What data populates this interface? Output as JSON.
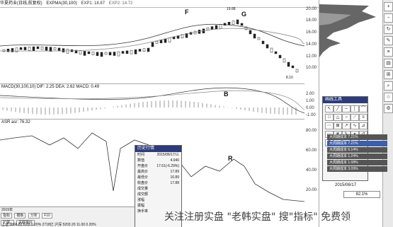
{
  "title_bar": {
    "stock": "华夏药业(日线,前复权)",
    "indicator": "EXPMA(30,100)",
    "exp1": "EXP1: 18.87",
    "exp2": "EXP2: 14.72"
  },
  "price_axis": [
    "20.00",
    "18.00",
    "16.00",
    "14.00",
    "12.00",
    "10.00",
    "8.10"
  ],
  "price_labels": {
    "high": "19.88",
    "low": "8.10"
  },
  "annotations": {
    "f": "F",
    "g": "G",
    "b": "B",
    "r": "R",
    "p": "P"
  },
  "macd_label": "MACD(30,100,10)  DIF: 2.25  DEA: 2.62  MACD: 0.49",
  "macd_axis": [
    "2.00",
    "1.00",
    "0.00",
    "-1.00"
  ],
  "asr_label": "ASR  asr: 76.32",
  "asr_axis": [
    "80.00",
    "60.00",
    "40.00",
    "20.00"
  ],
  "side_panel": {
    "code": "000153",
    "date": "2015/06/17",
    "percent": "82.1%"
  },
  "drawing_tool": {
    "title": "画线工具",
    "tools": [
      "↖",
      "╱",
      "─",
      "│",
      "⌒",
      "□",
      "△",
      "○",
      "⟋",
      "≡",
      "⋯",
      "⊞",
      "↗",
      "∿",
      "⊿",
      "▭",
      "⊗",
      "✎",
      "⌖",
      "↺",
      "T",
      "↑",
      "↓",
      "⊕",
      "✕"
    ]
  },
  "side_menu": [
    "大周期成本 7.21%",
    "大周期成本 7.21%",
    "大周期成本 6.14%",
    "大周期成本 1.24%",
    "大周期成本 1.08%",
    "大周期成本 3.09%"
  ],
  "history_popup": {
    "title": "历史行情",
    "rows": [
      {
        "k": "时间",
        "v": "2015/06/17/三"
      },
      {
        "k": "数值",
        "v": "4.040"
      },
      {
        "k": "开盘价",
        "v": "17.61(-6.29%)"
      },
      {
        "k": "最高价",
        "v": "17.89"
      },
      {
        "k": "最低价",
        "v": "16.89"
      },
      {
        "k": "收盘价",
        "v": "17.88"
      },
      {
        "k": "成交量",
        "v": ""
      },
      {
        "k": "成交额",
        "v": ""
      },
      {
        "k": "涨幅",
        "v": ""
      },
      {
        "k": "振幅",
        "v": ""
      },
      {
        "k": "换手率",
        "v": ""
      }
    ]
  },
  "bottom": {
    "tabs": [
      "指标",
      "模板",
      "分析",
      "F10"
    ],
    "tabs2": [
      "扩展↓",
      "关联报价"
    ],
    "year": "2015年",
    "status": "上证 3866.82  8.03  0.20%  2718亿  沪深 5203.20  11.00  0.20%"
  },
  "watermark": "关注注册实盘 \"老韩实盘\" 搜\"指标\" 免费领"
}
